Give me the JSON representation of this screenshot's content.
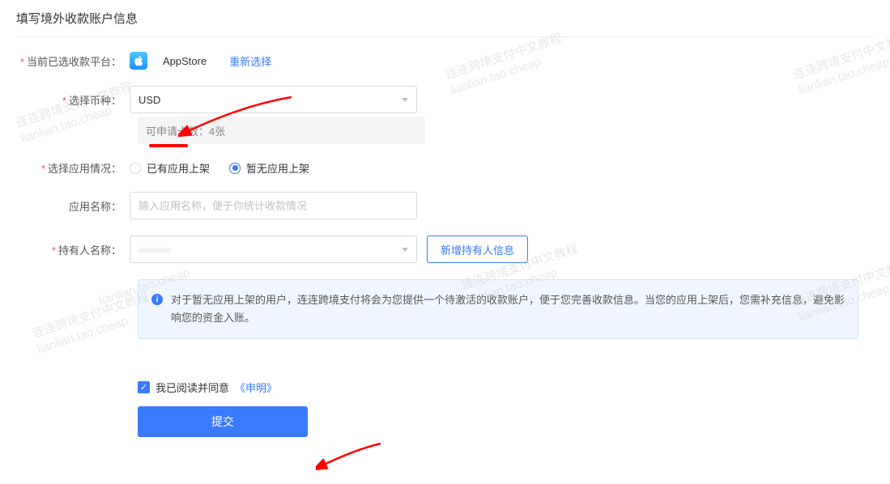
{
  "page_title": "填写境外收款账户信息",
  "platform": {
    "label": "当前已选收款平台：",
    "name": "AppStore",
    "reselect": "重新选择"
  },
  "currency": {
    "label": "选择币种：",
    "value": "USD",
    "quota_text": "可申请卡数：4张"
  },
  "app_status": {
    "label": "选择应用情况：",
    "option_has": "已有应用上架",
    "option_none": "暂无应用上架"
  },
  "app_name": {
    "label": "应用名称：",
    "placeholder": "输入应用名称，便于你统计收款情况"
  },
  "holder": {
    "label": "持有人名称：",
    "add_button": "新增持有人信息"
  },
  "notice": "对于暂无应用上架的用户，连连跨境支付将会为您提供一个待激活的收款账户，便于您完善收款信息。当您的应用上架后，您需补充信息，避免影响您的资金入账。",
  "agree": {
    "text": "我已阅读并同意",
    "link": "《申明》"
  },
  "submit": "提交",
  "watermark_cn": "连连跨境支付中文教程",
  "watermark_en": "lianlian.tao.cheap"
}
